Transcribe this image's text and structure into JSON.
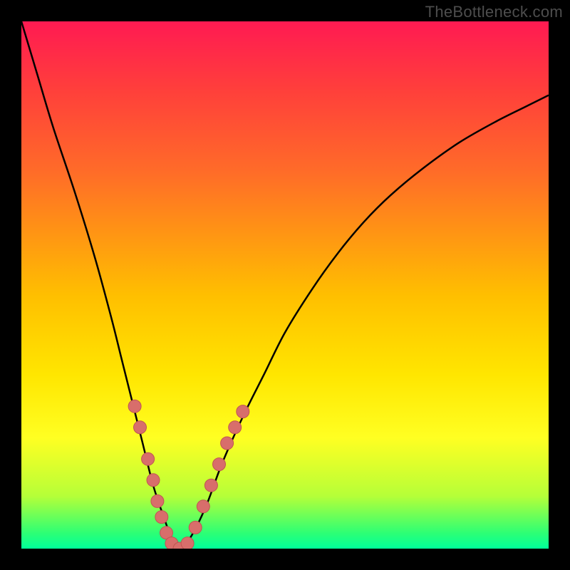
{
  "watermark": "TheBottleneck.com",
  "colors": {
    "frame": "#000000",
    "curve": "#000000",
    "marker_fill": "#d86e6b",
    "marker_stroke": "#c05552"
  },
  "chart_data": {
    "type": "line",
    "title": "",
    "xlabel": "",
    "ylabel": "",
    "xlim": [
      0,
      100
    ],
    "ylim": [
      0,
      100
    ],
    "series": [
      {
        "name": "bottleneck-curve",
        "x": [
          0,
          3,
          6,
          10,
          14,
          17,
          19,
          21,
          23,
          25,
          27,
          28.5,
          30,
          32,
          35,
          38,
          42,
          46,
          50,
          55,
          60,
          65,
          70,
          76,
          83,
          90,
          96,
          100
        ],
        "y": [
          100,
          90,
          80,
          68,
          55,
          44,
          36,
          28,
          20,
          12,
          6,
          2,
          0,
          2,
          8,
          16,
          25,
          33,
          41,
          49,
          56,
          62,
          67,
          72,
          77,
          81,
          84,
          86
        ]
      }
    ],
    "markers": {
      "name": "highlight-points",
      "points": [
        {
          "x": 21.5,
          "y": 27
        },
        {
          "x": 22.5,
          "y": 23
        },
        {
          "x": 24,
          "y": 17
        },
        {
          "x": 25,
          "y": 13
        },
        {
          "x": 25.8,
          "y": 9
        },
        {
          "x": 26.6,
          "y": 6
        },
        {
          "x": 27.5,
          "y": 3
        },
        {
          "x": 28.5,
          "y": 1
        },
        {
          "x": 30,
          "y": 0
        },
        {
          "x": 31.5,
          "y": 1
        },
        {
          "x": 33,
          "y": 4
        },
        {
          "x": 34.5,
          "y": 8
        },
        {
          "x": 36,
          "y": 12
        },
        {
          "x": 37.5,
          "y": 16
        },
        {
          "x": 39,
          "y": 20
        },
        {
          "x": 40.5,
          "y": 23
        },
        {
          "x": 42,
          "y": 26
        }
      ]
    }
  }
}
